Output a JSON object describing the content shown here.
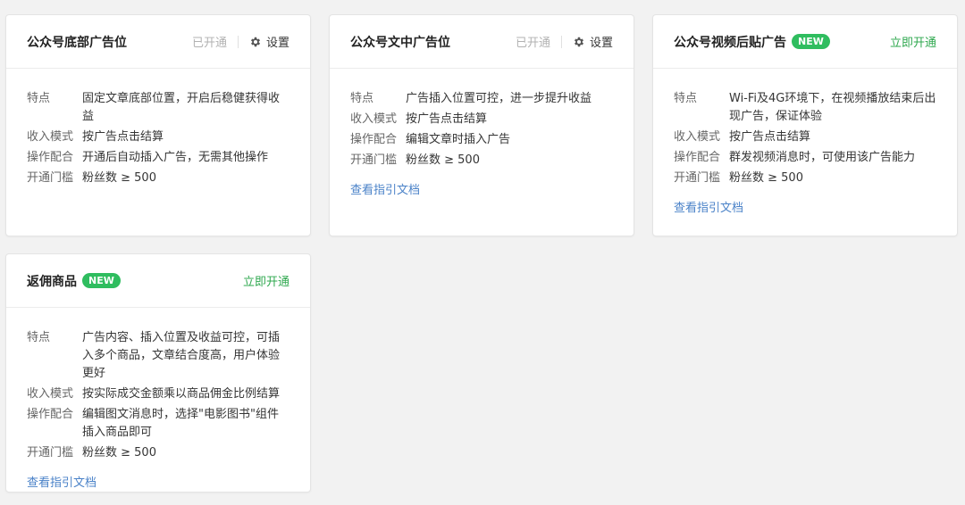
{
  "cards": [
    {
      "title": "公众号底部广告位",
      "status": "已开通",
      "settings_label": "设置",
      "rows": [
        {
          "label": "特点",
          "value": "固定文章底部位置，开启后稳健获得收益"
        },
        {
          "label": "收入模式",
          "value": "按广告点击结算"
        },
        {
          "label": "操作配合",
          "value": "开通后自动插入广告，无需其他操作"
        },
        {
          "label": "开通门槛",
          "value": "粉丝数 ≥ 500"
        }
      ]
    },
    {
      "title": "公众号文中广告位",
      "status": "已开通",
      "settings_label": "设置",
      "rows": [
        {
          "label": "特点",
          "value": "广告插入位置可控，进一步提升收益"
        },
        {
          "label": "收入模式",
          "value": "按广告点击结算"
        },
        {
          "label": "操作配合",
          "value": "编辑文章时插入广告"
        },
        {
          "label": "开通门槛",
          "value": "粉丝数 ≥ 500"
        }
      ],
      "doc_link": "查看指引文档"
    },
    {
      "title": "公众号视频后贴广告",
      "badge": "NEW",
      "open_label": "立即开通",
      "rows": [
        {
          "label": "特点",
          "value": "Wi-Fi及4G环境下，在视频播放结束后出现广告，保证体验"
        },
        {
          "label": "收入模式",
          "value": "按广告点击结算"
        },
        {
          "label": "操作配合",
          "value": "群发视频消息时，可使用该广告能力"
        },
        {
          "label": "开通门槛",
          "value": "粉丝数 ≥ 500"
        }
      ],
      "doc_link": "查看指引文档"
    },
    {
      "title": "返佣商品",
      "badge": "NEW",
      "open_label": "立即开通",
      "rows": [
        {
          "label": "特点",
          "value": "广告内容、插入位置及收益可控，可插入多个商品，文章结合度高，用户体验更好"
        },
        {
          "label": "收入模式",
          "value": "按实际成交金额乘以商品佣金比例结算"
        },
        {
          "label": "操作配合",
          "value": "编辑图文消息时，选择\"电影图书\"组件插入商品即可"
        },
        {
          "label": "开通门槛",
          "value": "粉丝数 ≥ 500"
        }
      ],
      "doc_link": "查看指引文档"
    }
  ],
  "colors": {
    "accent_green": "#2fbd5f",
    "link_blue": "#4a82c8",
    "muted": "#b2b2b2"
  },
  "icons": {
    "settings": "gear-icon"
  }
}
